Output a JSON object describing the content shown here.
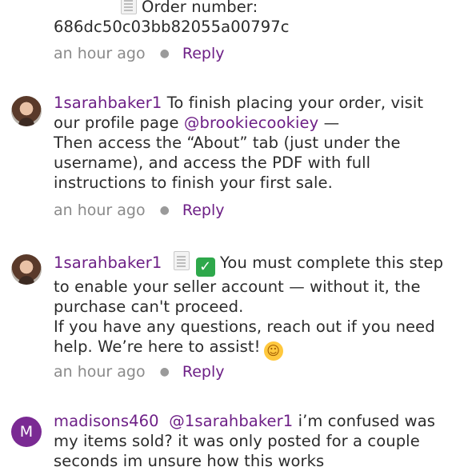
{
  "comments": [
    {
      "order_label": "Order number:",
      "order_number": "686dc50c03bb82055a00797c",
      "time": "an hour ago",
      "reply": "Reply"
    },
    {
      "username": "1sarahbaker1",
      "text_a": " To finish placing your order, visit our profile page ",
      "mention": "@brookiecookiey",
      "text_b": " —",
      "line2": "Then access the “About” tab (just under the username), and access the PDF with full instructions to finish your first sale.",
      "time": "an hour ago",
      "reply": "Reply"
    },
    {
      "username": "1sarahbaker1",
      "text_a": " You must complete this step to enable your seller account — without it, the purchase can't proceed.",
      "line2": "If you have any questions, reach out if you need help. We’re here to assist!",
      "time": "an hour ago",
      "reply": "Reply"
    },
    {
      "avatar_letter": "M",
      "username": "madisons460",
      "mention": "@1sarahbaker1",
      "text_a": " i’m confused was my items sold? it was only posted for a couple seconds im unsure how this works"
    }
  ],
  "colors": {
    "accent": "#6d1f86",
    "meta": "#8a8a8a",
    "avatar_m": "#7a2a93"
  },
  "icons": [
    "document-icon",
    "check-mark-icon",
    "smiling-face-icon"
  ]
}
